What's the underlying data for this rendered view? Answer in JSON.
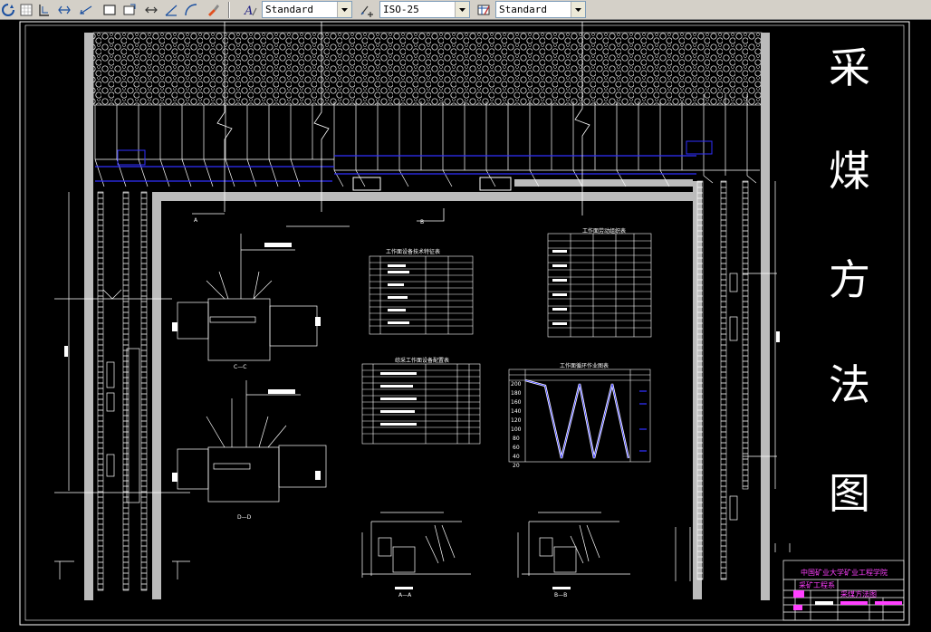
{
  "toolbar": {
    "text_style": "Standard",
    "dim_style": "ISO-25",
    "table_style": "Standard",
    "icons": [
      "orbit-icon",
      "grid-icon",
      "ortho-icon",
      "dim-linear-icon",
      "dim-aligned-icon",
      "rectangle-icon",
      "region-icon",
      "move-icon",
      "angle-icon",
      "arc-icon",
      "paint-icon",
      "text-style-icon",
      "dim-style-icon",
      "table-style-icon"
    ]
  },
  "drawing": {
    "title_chars": [
      "采",
      "煤",
      "方",
      "法",
      "图"
    ],
    "table_titles": [
      "工作面设备技术特征表",
      "工作面劳动组织表",
      "综采工作面设备配置表",
      "工作面循环作业图表"
    ],
    "titleblock": {
      "line1": "中国矿业大学矿业工程学院",
      "line2": "采矿工程系",
      "line3": "采煤方法图"
    },
    "section_labels": [
      "C—C",
      "D—D",
      "A—A",
      "B—B",
      "A",
      "B"
    ],
    "chart_axis_labels": [
      "200",
      "180",
      "160",
      "140",
      "120",
      "100",
      "80",
      "60",
      "40",
      "20"
    ]
  },
  "colors": {
    "accent": "#ff40ff",
    "blue": "#3030ff",
    "line": "#ffffff"
  }
}
